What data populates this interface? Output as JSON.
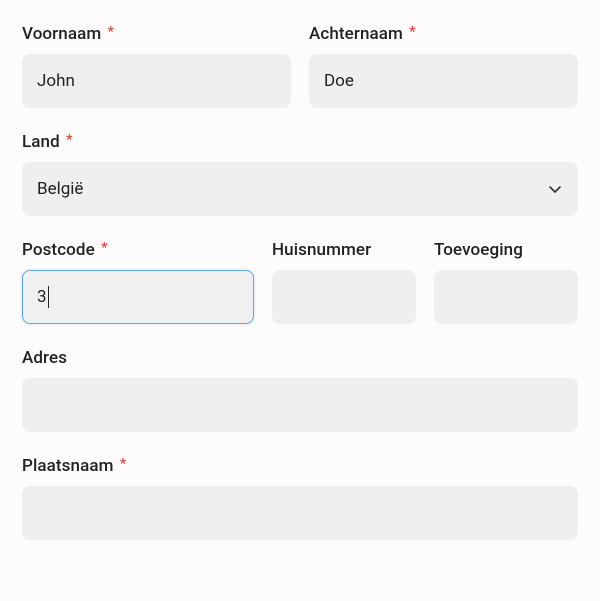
{
  "form": {
    "firstName": {
      "label": "Voornaam",
      "required": true,
      "value": "John"
    },
    "lastName": {
      "label": "Achternaam",
      "required": true,
      "value": "Doe"
    },
    "country": {
      "label": "Land",
      "required": true,
      "value": "België"
    },
    "postcode": {
      "label": "Postcode",
      "required": true,
      "value": "3"
    },
    "houseNumber": {
      "label": "Huisnummer",
      "required": false,
      "value": ""
    },
    "addition": {
      "label": "Toevoeging",
      "required": false,
      "value": ""
    },
    "address": {
      "label": "Adres",
      "required": false,
      "value": ""
    },
    "city": {
      "label": "Plaatsnaam",
      "required": true,
      "value": ""
    }
  },
  "symbols": {
    "required": "*"
  }
}
